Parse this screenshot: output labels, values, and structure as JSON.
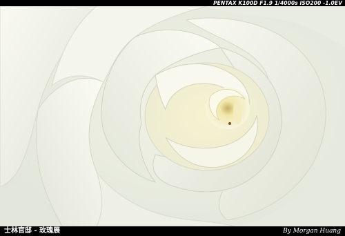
{
  "photo": {
    "subject": "white-rose",
    "accent_colors": {
      "petal_light": "#f6f6ec",
      "petal_shadow": "#d9ddc9",
      "center_yellow": "#efe6a6",
      "background": "#e5e8df"
    }
  },
  "captions": {
    "camera_info": "PENTAX K100D F1.9 1/4000s ISO200 -1.0EV",
    "location_title": "士林官邸 - 玫瑰展",
    "signature": "By Morgan Huang"
  }
}
